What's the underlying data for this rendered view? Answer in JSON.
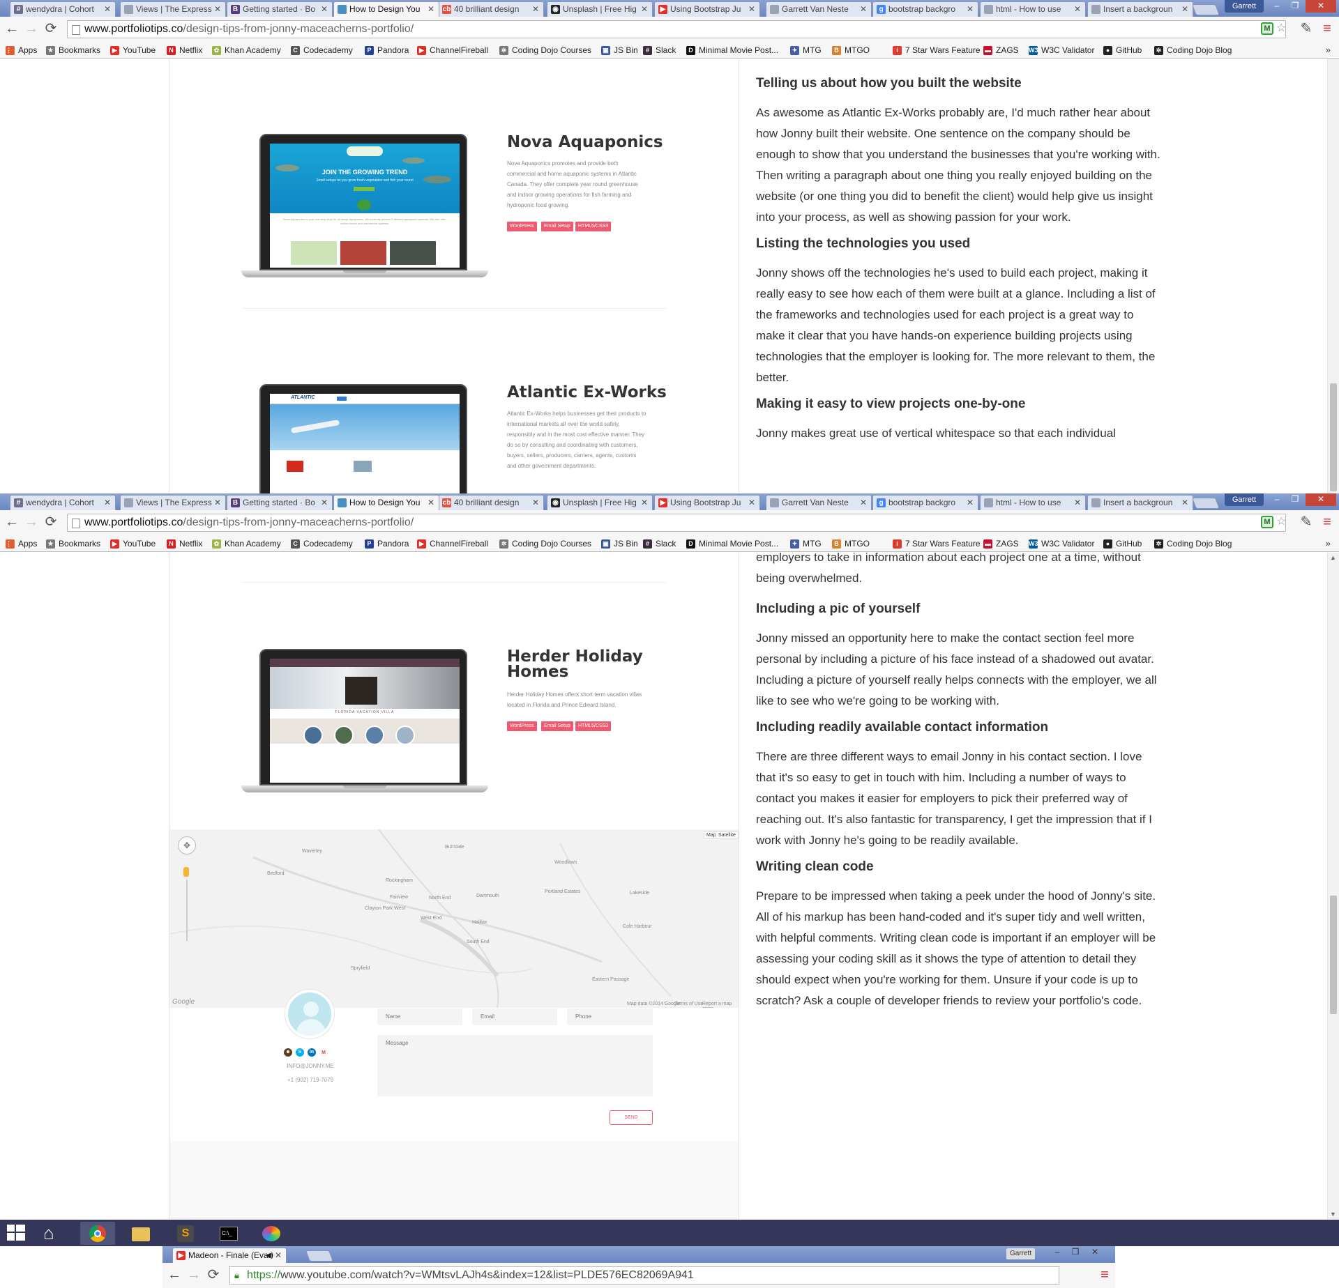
{
  "browser": {
    "user": "Garrett",
    "tabs": [
      {
        "label": "wendydra | Cohort",
        "icon": "hash-icon",
        "color": "#6e6e8e",
        "glyph": "#"
      },
      {
        "label": "Views | The Express",
        "icon": "page-icon",
        "color": "#9aa3b5",
        "glyph": ""
      },
      {
        "label": "Getting started · Bo",
        "icon": "bootstrap-icon",
        "color": "#563d7c",
        "glyph": "B"
      },
      {
        "label": "How to Design You",
        "icon": "portfoliotips-icon",
        "color": "#4a8fc0",
        "glyph": "",
        "active": true
      },
      {
        "label": "40 brilliant design",
        "icon": "creativebloq-icon",
        "color": "#e0523f",
        "glyph": "cb"
      },
      {
        "label": "Unsplash | Free Hig",
        "icon": "camera-icon",
        "color": "#222222",
        "glyph": "◉"
      },
      {
        "label": "Using Bootstrap Ju",
        "icon": "youtube-icon",
        "color": "#e52d27",
        "glyph": "▶"
      },
      {
        "label": "Garrett Van Neste",
        "icon": "page-icon",
        "color": "#9aa3b5",
        "glyph": ""
      },
      {
        "label": "bootstrap backgro",
        "icon": "google-icon",
        "color": "#4285f4",
        "glyph": "g"
      },
      {
        "label": "html - How to use",
        "icon": "page-icon",
        "color": "#9aa3b5",
        "glyph": ""
      },
      {
        "label": "Insert a backgroun",
        "icon": "page-icon",
        "color": "#9aa3b5",
        "glyph": ""
      }
    ],
    "url": {
      "domain": "www.portfoliotips.co",
      "path": "/design-tips-from-jonny-maceacherns-portfolio/"
    },
    "bookmarks": [
      {
        "label": "Apps",
        "icon": "apps-grid-icon",
        "color": "#e35b2e",
        "glyph": "⋮⋮"
      },
      {
        "label": "Bookmarks",
        "icon": "star-icon",
        "color": "#777777",
        "glyph": "★"
      },
      {
        "label": "YouTube",
        "icon": "youtube-icon",
        "color": "#e52d27",
        "glyph": "▶"
      },
      {
        "label": "Netflix",
        "icon": "netflix-icon",
        "color": "#d81f26",
        "glyph": "N"
      },
      {
        "label": "Khan Academy",
        "icon": "khan-academy-icon",
        "color": "#9cb443",
        "glyph": "✿"
      },
      {
        "label": "Codecademy",
        "icon": "codecademy-icon",
        "color": "#555555",
        "glyph": "C"
      },
      {
        "label": "Pandora",
        "icon": "pandora-icon",
        "color": "#224099",
        "glyph": "P"
      },
      {
        "label": "ChannelFireball",
        "icon": "youtube-icon",
        "color": "#e52d27",
        "glyph": "▶"
      },
      {
        "label": "Coding Dojo Courses",
        "icon": "dojo-icon",
        "color": "#777777",
        "glyph": "✲"
      },
      {
        "label": "JS Bin",
        "icon": "jsbin-icon",
        "color": "#3b5998",
        "glyph": "▣"
      },
      {
        "label": "Slack",
        "icon": "slack-icon",
        "color": "#3c2a3e",
        "glyph": "#"
      },
      {
        "label": "Minimal Movie Post...",
        "icon": "d-icon",
        "color": "#111111",
        "glyph": "D"
      },
      {
        "label": "MTG",
        "icon": "mtg-icon",
        "color": "#4a5ea8",
        "glyph": "✦"
      },
      {
        "label": "MTGO",
        "icon": "mtgo-icon",
        "color": "#d9822b",
        "glyph": "B"
      },
      {
        "label": "7 Star Wars Feature ...",
        "icon": "info-icon",
        "color": "#e03a2f",
        "glyph": "i"
      },
      {
        "label": "ZAGS",
        "icon": "zags-icon",
        "color": "#c8102e",
        "glyph": "▬"
      },
      {
        "label": "W3C Validator",
        "icon": "w3c-icon",
        "color": "#005a9c",
        "glyph": "W3"
      },
      {
        "label": "GitHub",
        "icon": "github-icon",
        "color": "#222222",
        "glyph": "●"
      },
      {
        "label": "Coding Dojo Blog",
        "icon": "dojo-icon",
        "color": "#222222",
        "glyph": "✲"
      }
    ],
    "more": "»"
  },
  "window1": {
    "article": [
      {
        "heading": "Telling us about how you built the website",
        "body": "As awesome as Atlantic Ex-Works probably are, I'd much rather hear about how Jonny built their website. One sentence on the company should be enough to show that you understand the businesses that you're working with. Then writing a paragraph about one thing you really enjoyed building on the website (or one thing you did to benefit the client) would help give us insight into your process, as well as showing passion for your work."
      },
      {
        "heading": "Listing the technologies you used",
        "body": "Jonny shows off the technologies he's used to build each project, making it really easy to see how each of them were built at a glance. Including a list of the frameworks and technologies used for each project is a great way to make it clear that you have hands-on experience building projects using technologies that the employer is looking for. The more relevant to them, the better."
      },
      {
        "heading": "Making it easy to view projects one-by-one",
        "body": "Jonny makes great use of vertical whitespace so that each individual"
      }
    ],
    "projects": [
      {
        "title": "Nova Aquaponics",
        "desc": "Nova Aquaponics promotes and provide both commercial and home aquaponic systems in Atlantic Canada. They offer complete year round greenhouse and indoor growing operations for fish farming and hydroponic food growing.",
        "tags": [
          "WordPress",
          "Email Setup",
          "HTML5/CSS3"
        ],
        "screen_headline": "JOIN THE GROWING TREND",
        "screen_sub": "Small setups let you grow fresh vegetables and fish year round",
        "screen_body": "Nova Aquaponics is your one-stop shop for all things aquaponics. We currently provide 3 different aquaponic systems. We also offer custom-made and commercial systems."
      },
      {
        "title": "Atlantic Ex-Works",
        "desc": "Atlantic Ex-Works helps businesses get their products to international markets all over the world safely, responsibly and in the most cost effective manner. They do so by consulting and coordinating with customers, buyers, sellers, producers, carriers, agents, customs and other government departments.",
        "screen_logo": "ATLANTIC"
      }
    ]
  },
  "window2": {
    "article": [
      {
        "heading": "",
        "body": "employers to take in information about each project one at a time, without being overwhelmed."
      },
      {
        "heading": "Including a pic of yourself",
        "body": "Jonny missed an opportunity here to make the contact section feel more personal by including a picture of his face instead of a shadowed out avatar. Including a picture of yourself really helps connects with the employer, we all like to see who we're going to be working with."
      },
      {
        "heading": "Including readily available contact information",
        "body": "There are three different ways to email Jonny in his contact section. I love that it's so easy to get in touch with him. Including a number of ways to contact you makes it easier for employers to pick their preferred way of reaching out. It's also fantastic for transparency, I get the impression that if I work with Jonny he's going to be readily available."
      },
      {
        "heading": "Writing clean code",
        "body": "Prepare to be impressed when taking a peek under the hood of Jonny's site. All of his markup has been hand-coded and it's super tidy and well written, with helpful comments. Writing clean code is important if an employer will be assessing your coding skill as it shows the type of attention to detail they should expect when you're working for them. Unsure if your code is up to scratch? Ask a couple of developer friends to review your portfolio's code."
      }
    ],
    "project": {
      "title": "Herder Holiday Homes",
      "desc": "Herder Holiday Homes offers short term vacation villas located in Florida and Prince Edward Island.",
      "tags": [
        "WordPress",
        "Email Setup",
        "HTML5/CSS3"
      ],
      "screen_heading": "FLORIDA VACATION VILLA"
    },
    "map": {
      "labels": [
        "Burnside",
        "Woodlawn",
        "Dartmouth",
        "North End",
        "Halifax",
        "South End",
        "Fairview",
        "Clayton Park West",
        "Rockingham",
        "West End",
        "Portland Estates",
        "Eastern Passage",
        "Lakeside",
        "Bedford",
        "Cole Harbour",
        "Waverley",
        "Spryfield"
      ],
      "map_type": "Map",
      "satellite_type": "Satellite",
      "brand": "Google",
      "footer": "Map data ©2014 Google",
      "terms": "Terms of Use",
      "report": "Report a map error"
    },
    "contact": {
      "email": "INFO@JONNY.ME",
      "phone": "+1 (902) 719-7079",
      "name_placeholder": "Name",
      "email_placeholder": "Email",
      "phone_placeholder": "Phone",
      "message_placeholder": "Message",
      "send": "SEND"
    }
  },
  "window3": {
    "tab": "Madeon - Finale (Evan",
    "user": "Garrett",
    "url_scheme": "https://",
    "url": "www.youtube.com/watch?v=WMtsvLAJh4s&index=12&list=PLDE576EC82069A941"
  }
}
